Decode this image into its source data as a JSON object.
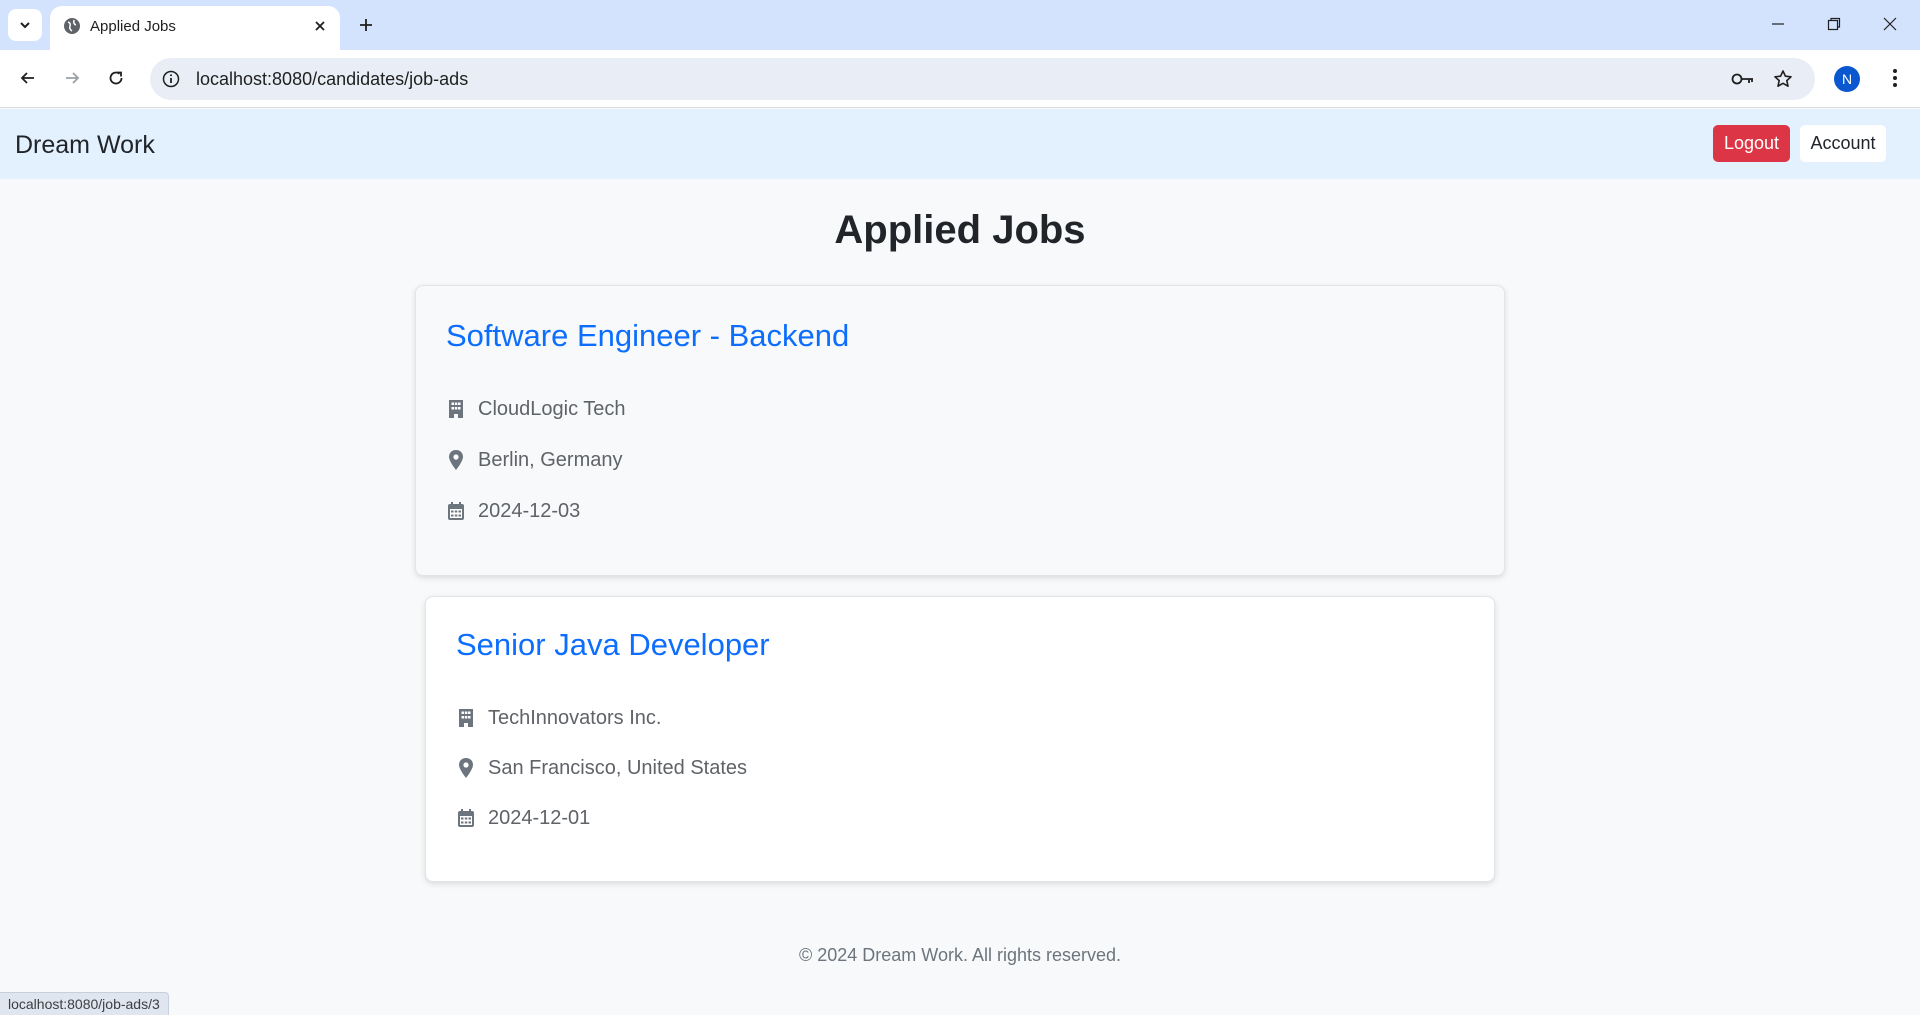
{
  "browser": {
    "tab_title": "Applied Jobs",
    "url": "localhost:8080/candidates/job-ads",
    "profile_initial": "N",
    "status_url": "localhost:8080/job-ads/3"
  },
  "navbar": {
    "brand": "Dream Work",
    "logout_label": "Logout",
    "account_label": "Account"
  },
  "page": {
    "title": "Applied Jobs"
  },
  "jobs": [
    {
      "title": "Software Engineer - Backend",
      "company": "CloudLogic Tech",
      "location": "Berlin, Germany",
      "date": "2024-12-03"
    },
    {
      "title": "Senior Java Developer",
      "company": "TechInnovators Inc.",
      "location": "San Francisco, United States",
      "date": "2024-12-01"
    }
  ],
  "footer": {
    "text": "© 2024 Dream Work. All rights reserved."
  },
  "colors": {
    "logout": "#dc3545",
    "link": "#0d6efd",
    "navbar_bg": "#e3f0fd"
  }
}
